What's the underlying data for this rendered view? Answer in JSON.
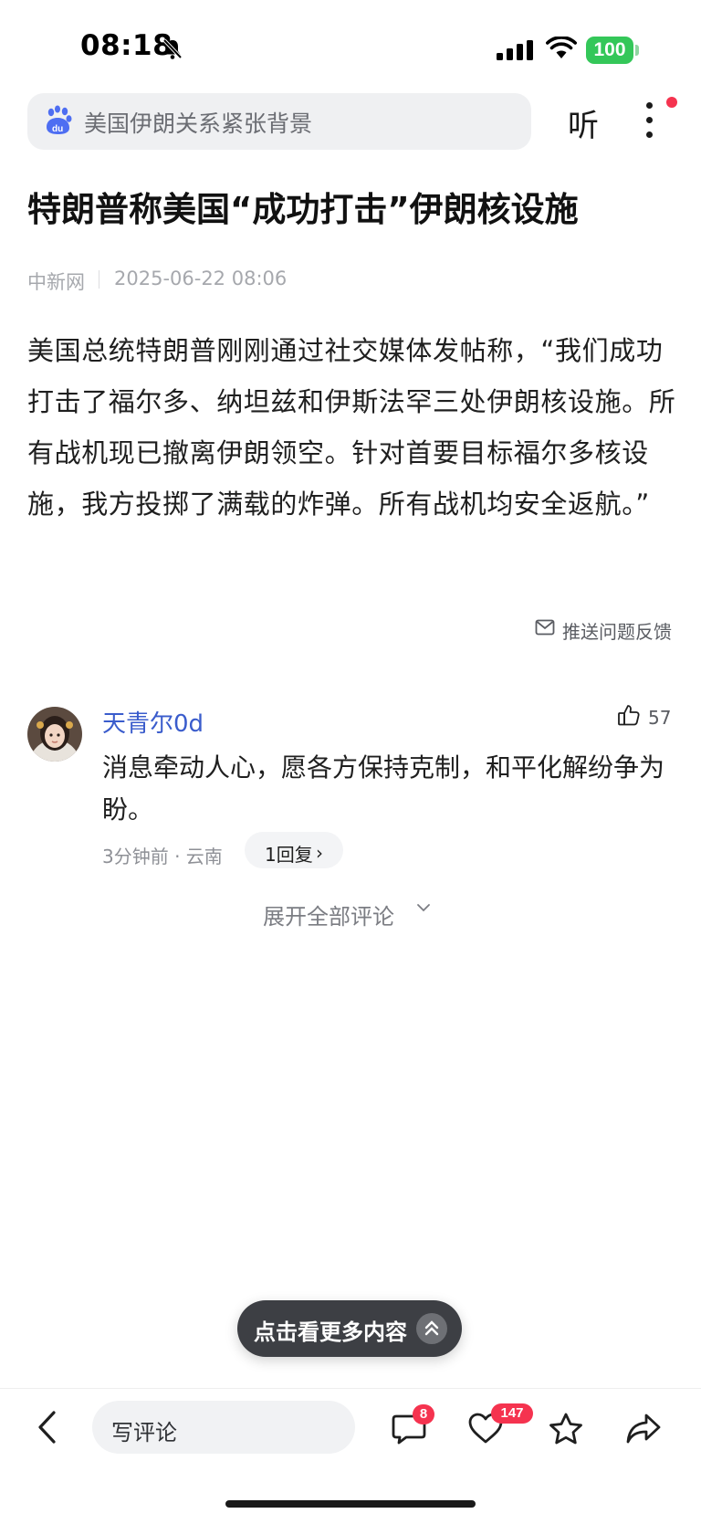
{
  "status_bar": {
    "time": "08:18",
    "battery": "100"
  },
  "search": {
    "query": "美国伊朗关系紧张背景",
    "listen_label": "听"
  },
  "article": {
    "title": "特朗普称美国“成功打击”伊朗核设施",
    "source": "中新网",
    "date": "2025-06-22 08:06",
    "body": "美国总统特朗普刚刚通过社交媒体发帖称，“我们成功打击了福尔多、纳坦兹和伊斯法罕三处伊朗核设施。所有战机现已撤离伊朗领空。针对首要目标福尔多核设施，我方投掷了满载的炸弹。所有战机均安全返航。”",
    "feedback_label": "推送问题反馈"
  },
  "comment": {
    "username": "天青尔0d",
    "likes": "57",
    "text": "消息牵动人心，愿各方保持克制，和平化解纷争为盼。",
    "time_location": "3分钟前 · 云南",
    "reply_label": "1回复",
    "reply_chevron": "›"
  },
  "expand_label": "展开全部评论",
  "floating_pill": {
    "label": "点击看更多内容"
  },
  "bottom_bar": {
    "comment_placeholder": "写评论",
    "comment_count": "8",
    "like_count": "147"
  },
  "colors": {
    "accent_blue": "#3a5ccc",
    "badge_red": "#f5334f",
    "battery_green": "#34c759"
  },
  "icons": [
    "bell-slash-icon",
    "signal-icon",
    "wifi-icon",
    "baidu-paw-icon",
    "more-vertical-icon",
    "mail-icon",
    "thumbs-up-icon",
    "chevron-down-icon",
    "double-chevron-up-icon",
    "back-arrow-icon",
    "comment-icon",
    "heart-icon",
    "star-icon",
    "share-icon"
  ]
}
